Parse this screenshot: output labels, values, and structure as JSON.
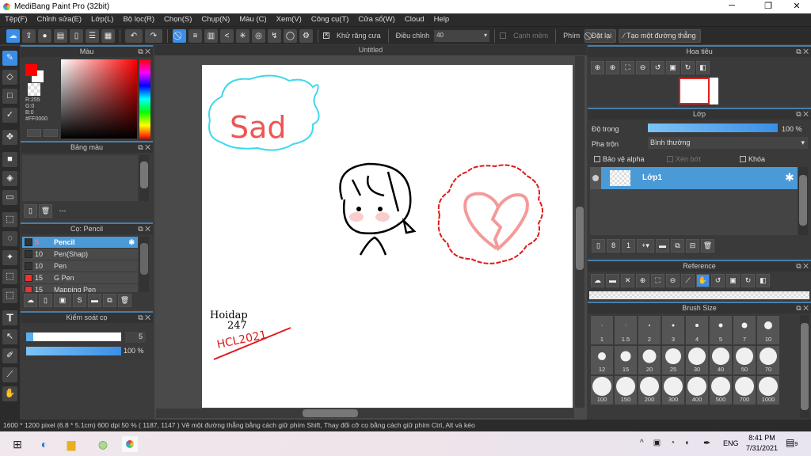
{
  "window": {
    "title": "MediBang Paint Pro (32bit)",
    "minimize": "─",
    "maximize": "❐",
    "close": "✕"
  },
  "menu": [
    "Tệp(F)",
    "Chỉnh sửa(E)",
    "Lớp(L)",
    "Bộ lọc(R)",
    "Chọn(S)",
    "Chụp(N)",
    "Màu (C)",
    "Xem(V)",
    "Công cụ(T)",
    "Cửa sổ(W)",
    "Cloud",
    "Help"
  ],
  "toolbar": {
    "antialias_label": "Khử răng cưa",
    "antialias_checked": true,
    "adjust_label": "Điều chỉnh",
    "adjust_value": "40",
    "soft_edge_label": "Cạnh mềm",
    "key_label": "Phím",
    "reset_label": "Đặt lại",
    "straight_line_label": "Tạo một đường thẳng"
  },
  "color_panel": {
    "title": "Màu",
    "r": "R:255",
    "g": "G:0",
    "b": "B:0",
    "hex": "#FF0000",
    "primary": "#ff0000",
    "secondary": "#ffffff"
  },
  "palette_panel": {
    "title": "Bảng màu",
    "name": "---"
  },
  "brush_panel": {
    "title": "Cọ: Pencil",
    "items": [
      {
        "size": "5",
        "name": "Pencil",
        "color": "#333333",
        "selected": true
      },
      {
        "size": "10",
        "name": "Pen(Shap)",
        "color": "#333333"
      },
      {
        "size": "10",
        "name": "Pen",
        "color": "#333333"
      },
      {
        "size": "15",
        "name": "G Pen",
        "color": "#ee3333"
      },
      {
        "size": "15",
        "name": "Mapping Pen",
        "color": "#ee3333"
      }
    ]
  },
  "brush_control": {
    "title": "Kiểm soát cọ",
    "size": "5",
    "opacity": "100 %",
    "opacity_value": 100
  },
  "canvas": {
    "tab": "Untitled",
    "art_text": {
      "sad": "Sad",
      "sig1": "Hoidap",
      "sig2": "247",
      "sig3": "HCL2021"
    }
  },
  "navigator": {
    "title": "Hoa tiêu"
  },
  "layers": {
    "title": "Lớp",
    "opacity_label": "Độ trong",
    "opacity": "100 %",
    "opacity_value": 100,
    "blend_label": "Pha trộn",
    "blend_value": "Bình thường",
    "protect_alpha": "Bảo vệ alpha",
    "clip": "Xén bớt",
    "lock": "Khóa",
    "items": [
      {
        "name": "Lớp1"
      }
    ]
  },
  "reference": {
    "title": "Reference"
  },
  "brush_size": {
    "title": "Brush Size",
    "sizes": [
      "1",
      "1.5",
      "2",
      "3",
      "4",
      "5",
      "7",
      "10",
      "12",
      "15",
      "20",
      "25",
      "30",
      "40",
      "50",
      "70",
      "100",
      "150",
      "200",
      "300",
      "400",
      "500",
      "700",
      "1000"
    ]
  },
  "status": {
    "text": "1600 * 1200 pixel   (6.8 * 5.1cm)   600 dpi   50 %   ( 1187, 1147 )   Vẽ một đường thẳng bằng cách giữ phím Shift, Thay đổi cỡ cọ bằng cách giữ phím Ctrl, Alt và kéo"
  },
  "taskbar": {
    "lang": "ENG",
    "time": "8:41 PM",
    "date": "7/31/2021",
    "notifications": "9"
  }
}
